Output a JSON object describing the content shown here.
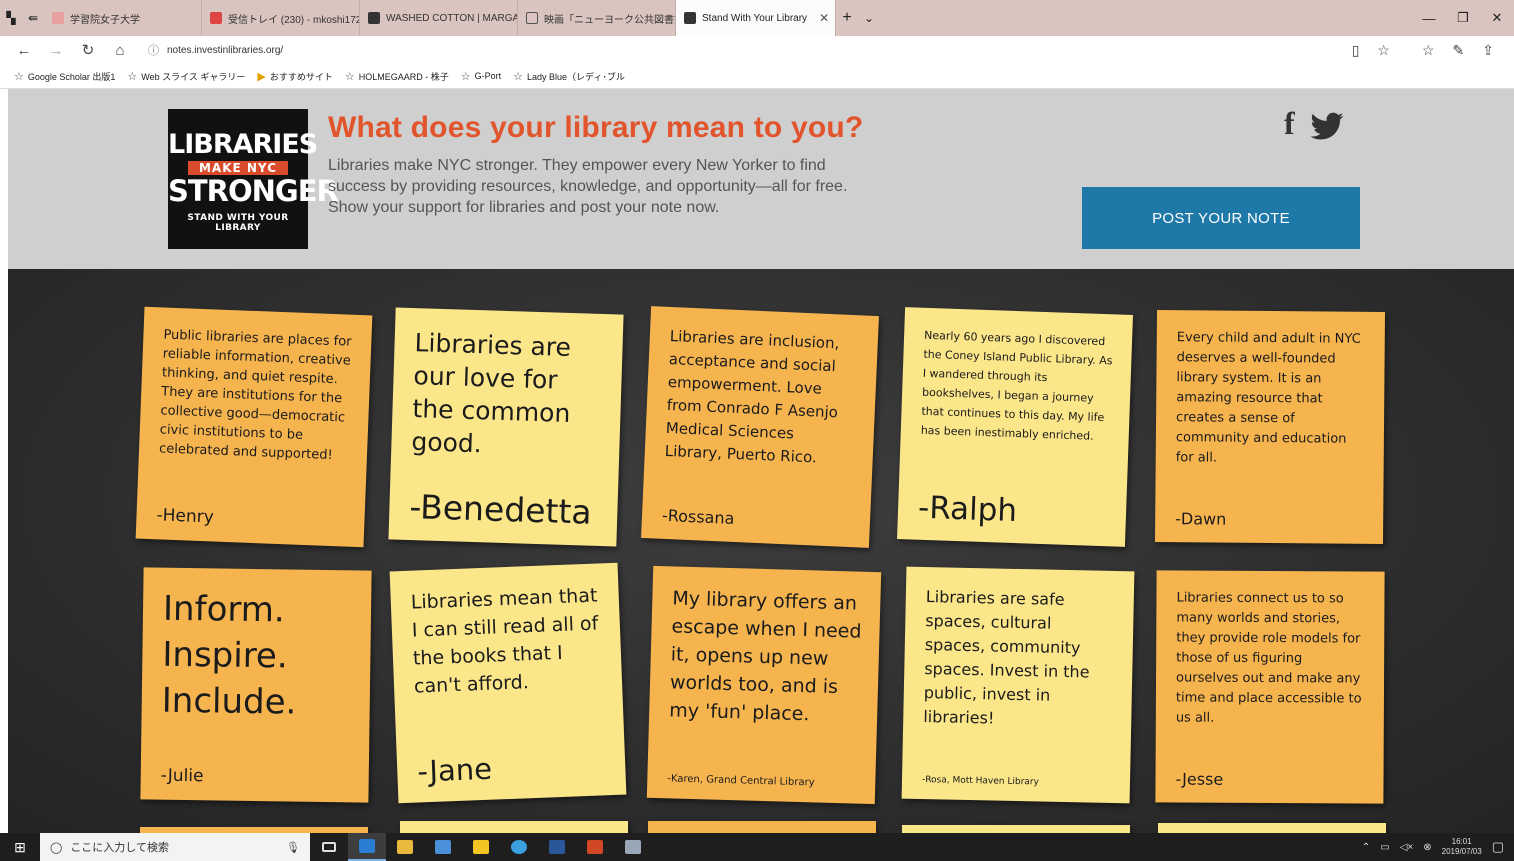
{
  "browser": {
    "tabs": [
      {
        "label": "学習院女子大学",
        "color": "#c44"
      },
      {
        "label": "受信トレイ (230) - mkoshi172",
        "color": "#d44"
      },
      {
        "label": "WASHED COTTON | MARGA",
        "color": "#333"
      },
      {
        "label": "映画「ニューヨーク公共図書館",
        "color": "#666"
      },
      {
        "label": "Stand With Your Library",
        "color": "#333"
      }
    ],
    "new_tab": "+",
    "url": "notes.investinlibraries.org/",
    "favorites": [
      "Google Scholar 出版1",
      "Web スライス ギャラリー",
      "おすすめサイト",
      "HOLMEGAARD - 株子",
      "G-Port",
      "Lady Blue（レディ･ブル"
    ]
  },
  "hero": {
    "logo": {
      "line1": "LIBRARIES",
      "line2": "MAKE NYC",
      "line3": "STRONGER",
      "line4": "STAND WITH YOUR LIBRARY"
    },
    "title": "What does your library mean to you?",
    "subtitle": "Libraries make NYC stronger. They empower every New Yorker to find success by providing resources, knowledge, and opportunity—all for free. Show your support for libraries and post your note now.",
    "cta": "POST YOUR NOTE",
    "facebook": "f"
  },
  "notes": [
    {
      "text": "Public libraries are places for reliable information, creative thinking, and quiet respite. They are institutions for the collective good—democratic civic institutions to be celebrated and supported!",
      "signature": "-Henry"
    },
    {
      "text": "Libraries are our love for the common good.",
      "signature": "-Benedetta"
    },
    {
      "text": "Libraries are inclusion, acceptance and social empowerment. Love from Conrado F Asenjo Medical Sciences Library, Puerto Rico.",
      "signature": "-Rossana"
    },
    {
      "text": "Nearly 60 years ago I discovered the Coney Island Public Library. As I wandered through its bookshelves, I began a journey that continues to this day. My life has been inestimably enriched.",
      "signature": "-Ralph"
    },
    {
      "text": "Every child and adult in NYC deserves a well-founded library system. It is an amazing resource that creates a sense of community and education for all.",
      "signature": "-Dawn"
    },
    {
      "text": "Inform. Inspire. Include.",
      "signature": "-Julie"
    },
    {
      "text": "Libraries mean that I can still read all of the books that I can't afford.",
      "signature": "-Jane"
    },
    {
      "text": "My library offers an escape when I need it, opens up new worlds too, and is my 'fun' place.",
      "signature": "-Karen, Grand Central Library"
    },
    {
      "text": "Libraries are safe spaces, cultural spaces, community spaces. Invest in the public, invest in libraries!",
      "signature": "-Rosa, Mott Haven Library"
    },
    {
      "text": "Libraries connect us to so many worlds and stories, they provide role models for those of us figuring ourselves out and make any time and place accessible to us all.",
      "signature": "-Jesse"
    }
  ],
  "taskbar": {
    "search_placeholder": "ここに入力して検索",
    "time": "16:01",
    "date": "2019/07/03"
  }
}
